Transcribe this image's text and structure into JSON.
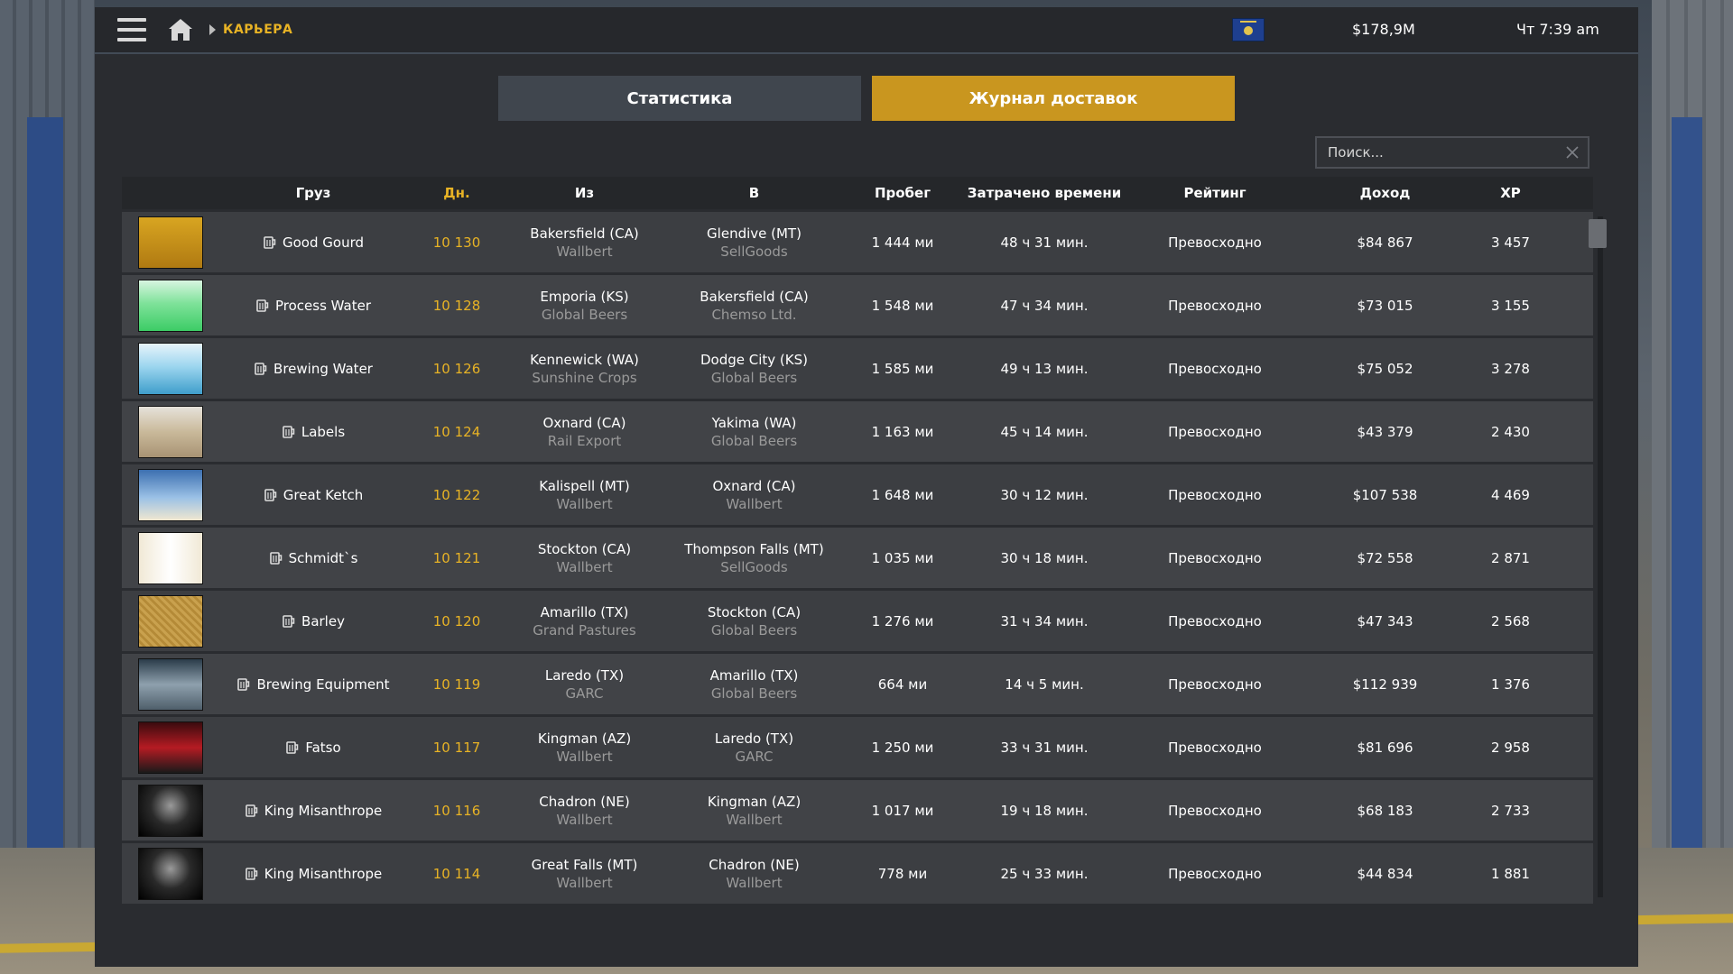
{
  "topbar": {
    "breadcrumb": "КАРЬЕРА",
    "money": "$178,9M",
    "clock": "Чт 7:39 am"
  },
  "tabs": [
    {
      "label": "Статистика",
      "active": false
    },
    {
      "label": "Журнал доставок",
      "active": true
    }
  ],
  "search": {
    "placeholder": "Поиск..."
  },
  "table": {
    "headers": [
      "Груз",
      "Дн.",
      "Из",
      "В",
      "Пробег",
      "Затрачено времени",
      "Рейтинг",
      "Доход",
      "XP"
    ],
    "rows": [
      {
        "thumb": "good-gourd",
        "cargo": "Good Gourd",
        "day": "10 130",
        "from_city": "Bakersfield (CA)",
        "from_company": "Wallbert",
        "to_city": "Glendive (MT)",
        "to_company": "SellGoods",
        "distance": "1 444 ми",
        "time": "48 ч 31 мин.",
        "rating": "Превосходно",
        "income": "$84 867",
        "xp": "3 457"
      },
      {
        "thumb": "process-water",
        "cargo": "Process Water",
        "day": "10 128",
        "from_city": "Emporia (KS)",
        "from_company": "Global Beers",
        "to_city": "Bakersfield (CA)",
        "to_company": "Chemso Ltd.",
        "distance": "1 548 ми",
        "time": "47 ч 34 мин.",
        "rating": "Превосходно",
        "income": "$73 015",
        "xp": "3 155"
      },
      {
        "thumb": "brewing-water",
        "cargo": "Brewing Water",
        "day": "10 126",
        "from_city": "Kennewick (WA)",
        "from_company": "Sunshine Crops",
        "to_city": "Dodge City (KS)",
        "to_company": "Global Beers",
        "distance": "1 585 ми",
        "time": "49 ч 13 мин.",
        "rating": "Превосходно",
        "income": "$75 052",
        "xp": "3 278"
      },
      {
        "thumb": "labels",
        "cargo": "Labels",
        "day": "10 124",
        "from_city": "Oxnard (CA)",
        "from_company": "Rail Export",
        "to_city": "Yakima (WA)",
        "to_company": "Global Beers",
        "distance": "1 163 ми",
        "time": "45 ч 14 мин.",
        "rating": "Превосходно",
        "income": "$43 379",
        "xp": "2 430"
      },
      {
        "thumb": "great-ketch",
        "cargo": "Great Ketch",
        "day": "10 122",
        "from_city": "Kalispell (MT)",
        "from_company": "Wallbert",
        "to_city": "Oxnard (CA)",
        "to_company": "Wallbert",
        "distance": "1 648 ми",
        "time": "30 ч 12 мин.",
        "rating": "Превосходно",
        "income": "$107 538",
        "xp": "4 469"
      },
      {
        "thumb": "schmidts",
        "cargo": "Schmidt`s",
        "day": "10 121",
        "from_city": "Stockton (CA)",
        "from_company": "Wallbert",
        "to_city": "Thompson Falls (MT)",
        "to_company": "SellGoods",
        "distance": "1 035 ми",
        "time": "30 ч 18 мин.",
        "rating": "Превосходно",
        "income": "$72 558",
        "xp": "2 871"
      },
      {
        "thumb": "barley",
        "cargo": "Barley",
        "day": "10 120",
        "from_city": "Amarillo (TX)",
        "from_company": "Grand Pastures",
        "to_city": "Stockton (CA)",
        "to_company": "Global Beers",
        "distance": "1 276 ми",
        "time": "31 ч 34 мин.",
        "rating": "Превосходно",
        "income": "$47 343",
        "xp": "2 568"
      },
      {
        "thumb": "brewing-equipment",
        "cargo": "Brewing Equipment",
        "day": "10 119",
        "from_city": "Laredo (TX)",
        "from_company": "GARC",
        "to_city": "Amarillo (TX)",
        "to_company": "Global Beers",
        "distance": "664 ми",
        "time": "14 ч 5 мин.",
        "rating": "Превосходно",
        "income": "$112 939",
        "xp": "1 376"
      },
      {
        "thumb": "fatso",
        "cargo": "Fatso",
        "day": "10 117",
        "from_city": "Kingman (AZ)",
        "from_company": "Wallbert",
        "to_city": "Laredo (TX)",
        "to_company": "GARC",
        "distance": "1 250 ми",
        "time": "33 ч 31 мин.",
        "rating": "Превосходно",
        "income": "$81 696",
        "xp": "2 958"
      },
      {
        "thumb": "king-misanthrope",
        "cargo": "King Misanthrope",
        "day": "10 116",
        "from_city": "Chadron (NE)",
        "from_company": "Wallbert",
        "to_city": "Kingman (AZ)",
        "to_company": "Wallbert",
        "distance": "1 017 ми",
        "time": "19 ч 18 мин.",
        "rating": "Превосходно",
        "income": "$68 183",
        "xp": "2 733"
      },
      {
        "thumb": "king-misanthrope",
        "cargo": "King Misanthrope",
        "day": "10 114",
        "from_city": "Great Falls (MT)",
        "from_company": "Wallbert",
        "to_city": "Chadron (NE)",
        "to_company": "Wallbert",
        "distance": "778 ми",
        "time": "25 ч 33 мин.",
        "rating": "Превосходно",
        "income": "$44 834",
        "xp": "1 881"
      }
    ]
  },
  "colors": {
    "accent": "#e8b325",
    "active_tab": "#c9961f",
    "inactive_tab": "#40464e",
    "panel": "#2a2c30",
    "row": "#3c3e42",
    "secondary_text": "#9a9a9a"
  },
  "icons": [
    "menu-icon",
    "home-icon",
    "chevron-right-icon",
    "flag-icon",
    "close-icon",
    "beer-mug-icon"
  ]
}
